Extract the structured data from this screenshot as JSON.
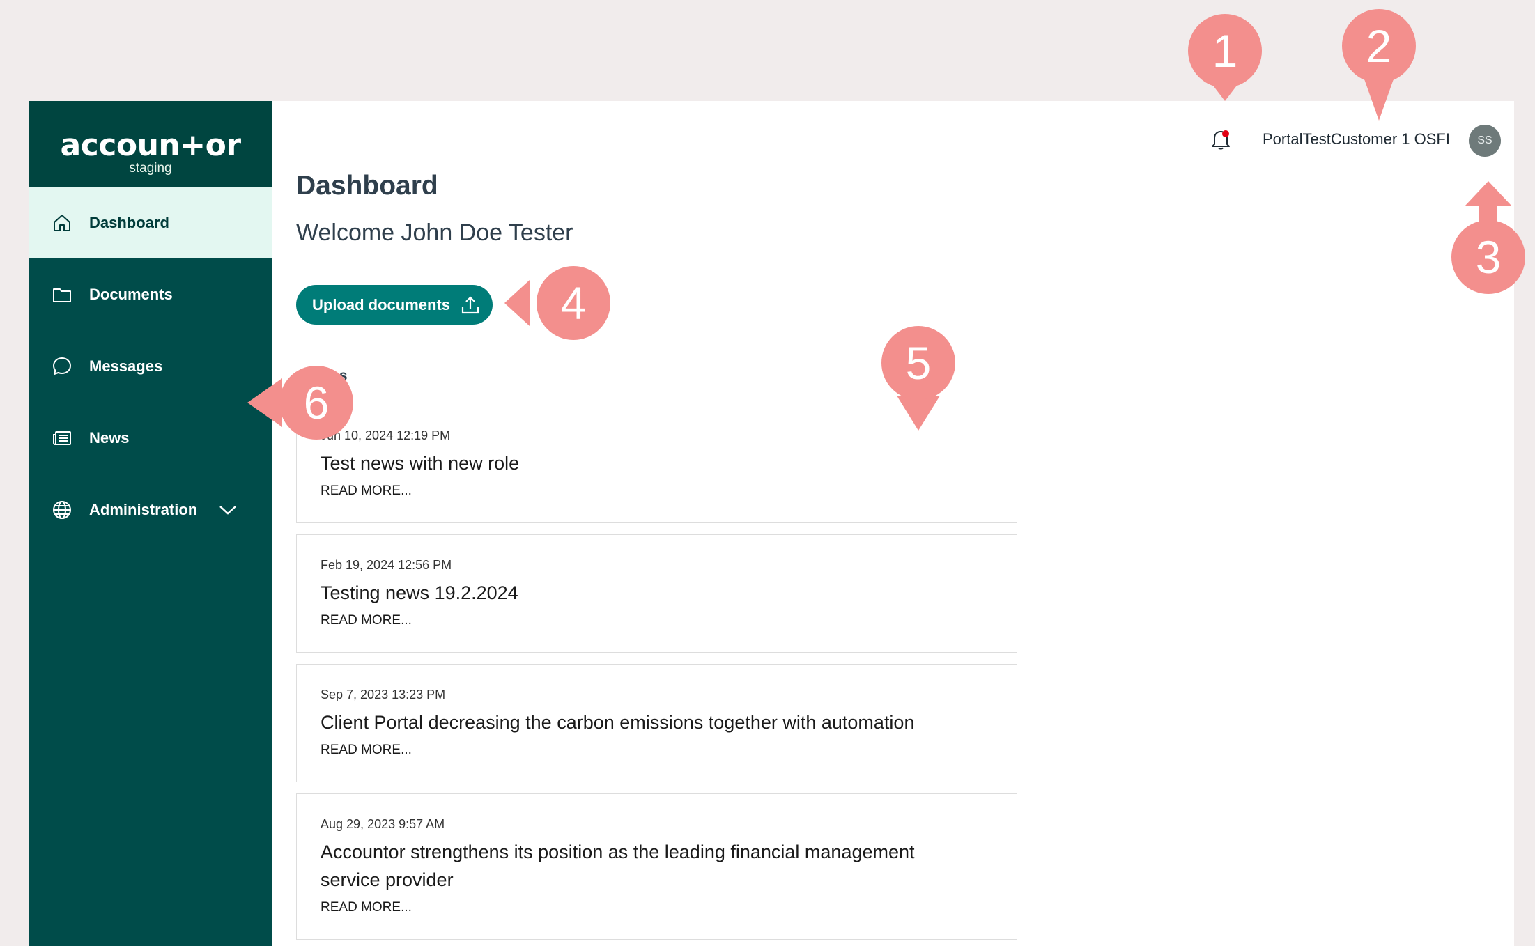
{
  "sidebar": {
    "logo": {
      "brand": "accoun+or",
      "environment": "staging"
    },
    "items": [
      {
        "label": "Dashboard",
        "icon": "home-icon",
        "active": true
      },
      {
        "label": "Documents",
        "icon": "folder-icon"
      },
      {
        "label": "Messages",
        "icon": "chat-bubble-icon"
      },
      {
        "label": "News",
        "icon": "newspaper-icon"
      },
      {
        "label": "Administration",
        "icon": "globe-icon",
        "expandable": true
      }
    ]
  },
  "header": {
    "notification_icon": "bell-icon",
    "has_unread": true,
    "customer_name": "PortalTestCustomer 1 OSFI",
    "avatar_initials": "SS"
  },
  "main": {
    "title": "Dashboard",
    "welcome": "Welcome John Doe Tester",
    "upload_button_label": "Upload documents",
    "upload_icon": "upload-icon",
    "section_title": "articles",
    "articles": [
      {
        "date": "Jun 10, 2024 12:19 PM",
        "title": "Test news with new role",
        "read_more": "READ MORE..."
      },
      {
        "date": "Feb 19, 2024 12:56 PM",
        "title": "Testing news 19.2.2024",
        "read_more": "READ MORE..."
      },
      {
        "date": "Sep 7, 2023 13:23 PM",
        "title": "Client Portal decreasing the carbon emissions together with automation",
        "read_more": "READ MORE..."
      },
      {
        "date": "Aug 29, 2023 9:57 AM",
        "title": "Accountor strengthens its position as the leading financial management service provider",
        "read_more": "READ MORE..."
      }
    ]
  },
  "annotations": [
    {
      "number": "1",
      "pointing": "down"
    },
    {
      "number": "2",
      "pointing": "down"
    },
    {
      "number": "3",
      "pointing": "up"
    },
    {
      "number": "4",
      "pointing": "left"
    },
    {
      "number": "5",
      "pointing": "down"
    },
    {
      "number": "6",
      "pointing": "left"
    }
  ],
  "colors": {
    "sidebar_bg": "#004c4a",
    "active_item_bg": "#e3f7f1",
    "primary_button": "#007c78",
    "annotation": "#f38f8d",
    "notification_dot": "#e00014"
  }
}
